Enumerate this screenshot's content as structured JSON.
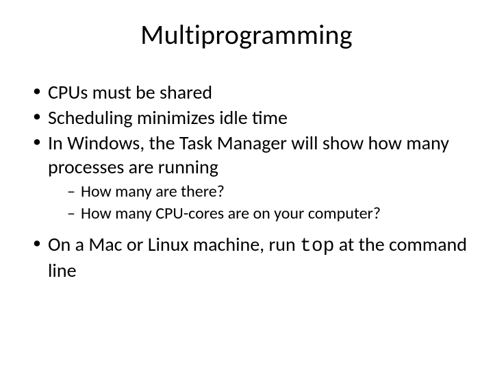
{
  "slide": {
    "title": "Multiprogramming",
    "bullets": {
      "b1": "CPUs must be shared",
      "b2": "Scheduling minimizes idle time",
      "b3": "In Windows, the Task Manager will show how many processes are running",
      "b3_sub": {
        "s1": "How many are there?",
        "s2": "How many CPU-cores are on your computer?"
      },
      "b4_pre": "On a Mac or Linux machine, run ",
      "b4_code": "top",
      "b4_post": " at the command line"
    }
  }
}
